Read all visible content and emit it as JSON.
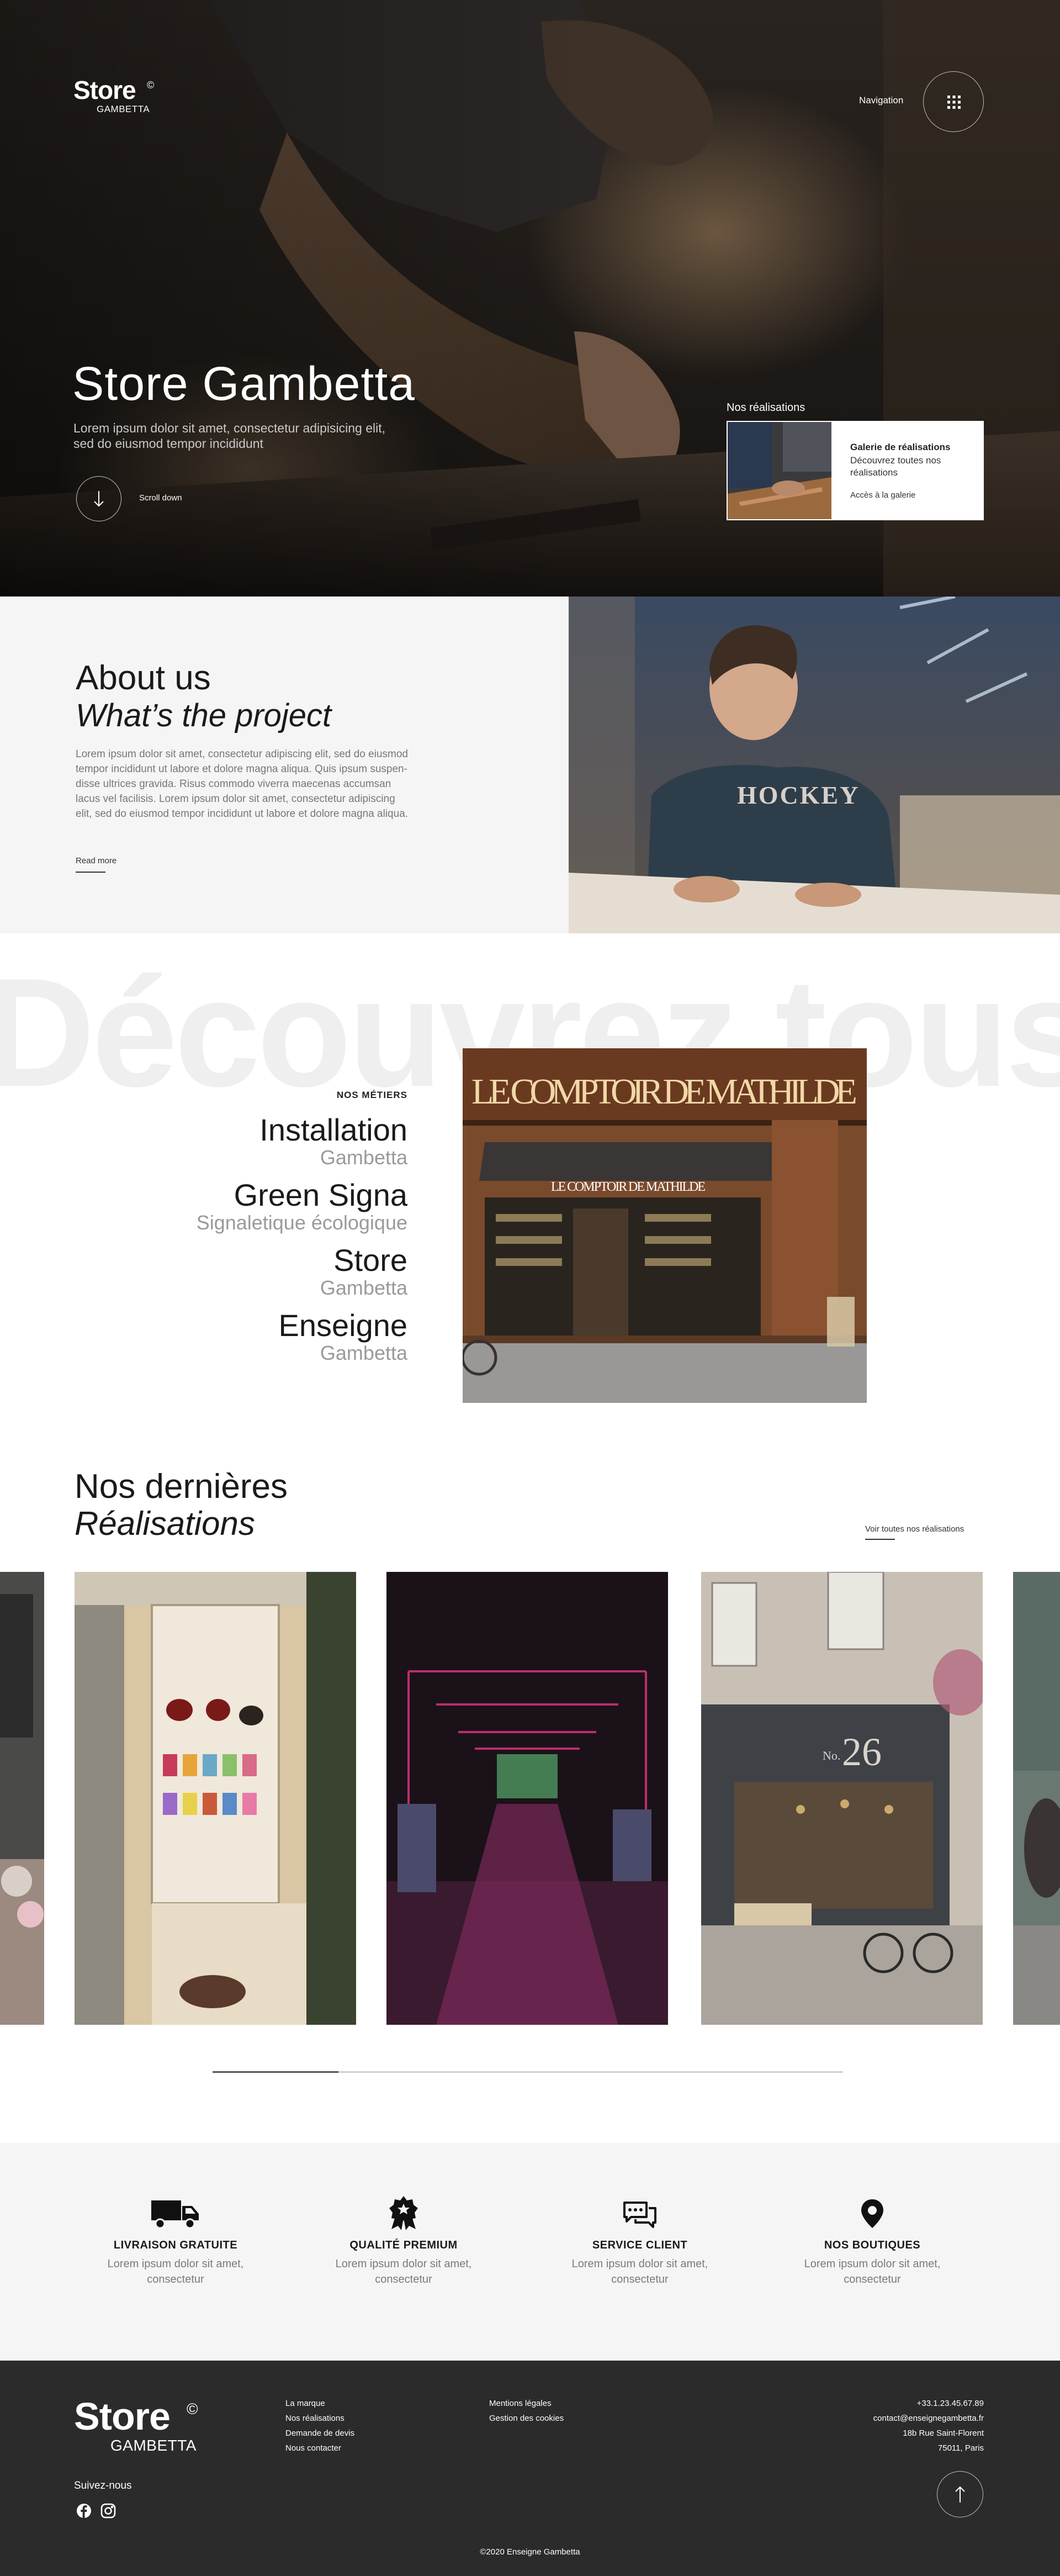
{
  "header": {
    "logo_main": "Store",
    "logo_reg": "©",
    "logo_sub": "GAMBETTA",
    "nav_label": "Navigation",
    "nav_icon": "grid-icon"
  },
  "hero": {
    "title": "Store Gambetta",
    "subtitle_line1": "Lorem ipsum dolor sit amet, consectetur adipisicing elit,",
    "subtitle_line2": "sed do eiusmod tempor incididunt",
    "scroll_label": "Scroll down",
    "card_heading": "Nos réalisations",
    "card_title": "Galerie de réalisations",
    "card_desc_line1": "Découvrez toutes nos",
    "card_desc_line2": "réalisations",
    "card_link": "Accès à la galerie"
  },
  "about": {
    "title": "About us",
    "subtitle": "What’s the project",
    "body": [
      "Lorem ipsum dolor sit amet, consectetur adipiscing elit, sed do eiusmod",
      "tempor incididunt ut labore et dolore magna aliqua. Quis ipsum suspen-",
      "disse ultrices gravida. Risus commodo viverra maecenas accumsan",
      "lacus vel facilisis. Lorem ipsum dolor sit amet, consectetur adipiscing",
      "elit, sed do eiusmod tempor incididunt ut labore et dolore magna aliqua."
    ],
    "read_more": "Read more"
  },
  "metiers": {
    "background_text": "Découvrez tous n",
    "label": "NOS MÉTIERS",
    "items": [
      {
        "title": "Installation",
        "sub": "Gambetta"
      },
      {
        "title": "Green Signa",
        "sub": "Signaletique écologique"
      },
      {
        "title": "Store",
        "sub": "Gambetta"
      },
      {
        "title": "Enseigne",
        "sub": "Gambetta"
      }
    ],
    "sign_text": "LE COMPTOIR DE MATHILDE",
    "awning_text": "LE COMPTOIR DE MATHILDE"
  },
  "realisations": {
    "title": "Nos dernières",
    "subtitle": "Réalisations",
    "view_all": "Voir toutes nos réalisations",
    "storefront_number": "26",
    "storefront_prefix": "No.",
    "slider_progress": 0.2
  },
  "features": [
    {
      "icon": "truck-icon",
      "title": "LIVRAISON GRATUITE",
      "desc_line1": "Lorem ipsum dolor sit amet,",
      "desc_line2": "consectetur"
    },
    {
      "icon": "award-icon",
      "title": "QUALITÉ PREMIUM",
      "desc_line1": "Lorem ipsum dolor sit amet,",
      "desc_line2": "consectetur"
    },
    {
      "icon": "chat-icon",
      "title": "SERVICE CLIENT",
      "desc_line1": "Lorem ipsum dolor sit amet,",
      "desc_line2": "consectetur"
    },
    {
      "icon": "map-pin-icon",
      "title": "NOS BOUTIQUES",
      "desc_line1": "Lorem ipsum dolor sit amet,",
      "desc_line2": "consectetur"
    }
  ],
  "footer": {
    "logo_main": "Store",
    "logo_reg": "©",
    "logo_sub": "GAMBETTA",
    "follow": "Suivez-nous",
    "col1": [
      "La marque",
      "Nos réalisations",
      "Demande de devis",
      "Nous contacter"
    ],
    "col2": [
      "Mentions légales",
      "Gestion des cookies"
    ],
    "phone": "+33.1.23.45.67.89",
    "email": "contact@enseignegambetta.fr",
    "address1": "18b Rue Saint-Florent",
    "address2": "75011, Paris",
    "copyright": "©2020 Enseigne Gambetta"
  }
}
